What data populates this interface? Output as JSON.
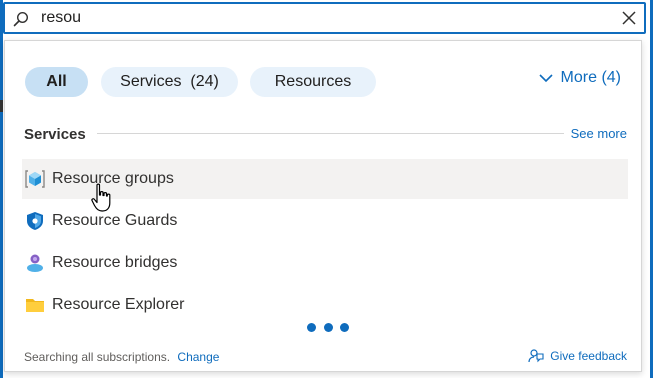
{
  "search": {
    "value": "resou",
    "placeholder": ""
  },
  "filters": {
    "all": "All",
    "services": "Services  (24)",
    "resources": "Resources",
    "more": "More (4)"
  },
  "services_section": {
    "title": "Services",
    "see_more": "See more",
    "items": [
      {
        "label": "Resource groups",
        "icon": "resource-groups-icon"
      },
      {
        "label": "Resource Guards",
        "icon": "shield-icon"
      },
      {
        "label": "Resource bridges",
        "icon": "resource-bridges-icon"
      },
      {
        "label": "Resource Explorer",
        "icon": "folder-icon"
      }
    ]
  },
  "footer": {
    "searching_text": "Searching all subscriptions.",
    "change_link": "Change",
    "feedback": "Give feedback"
  },
  "colors": {
    "accent": "#0f6cbd",
    "pill_selected": "#c7e0f4",
    "pill": "#e8f2fb",
    "hover_row": "#f3f2f1"
  }
}
